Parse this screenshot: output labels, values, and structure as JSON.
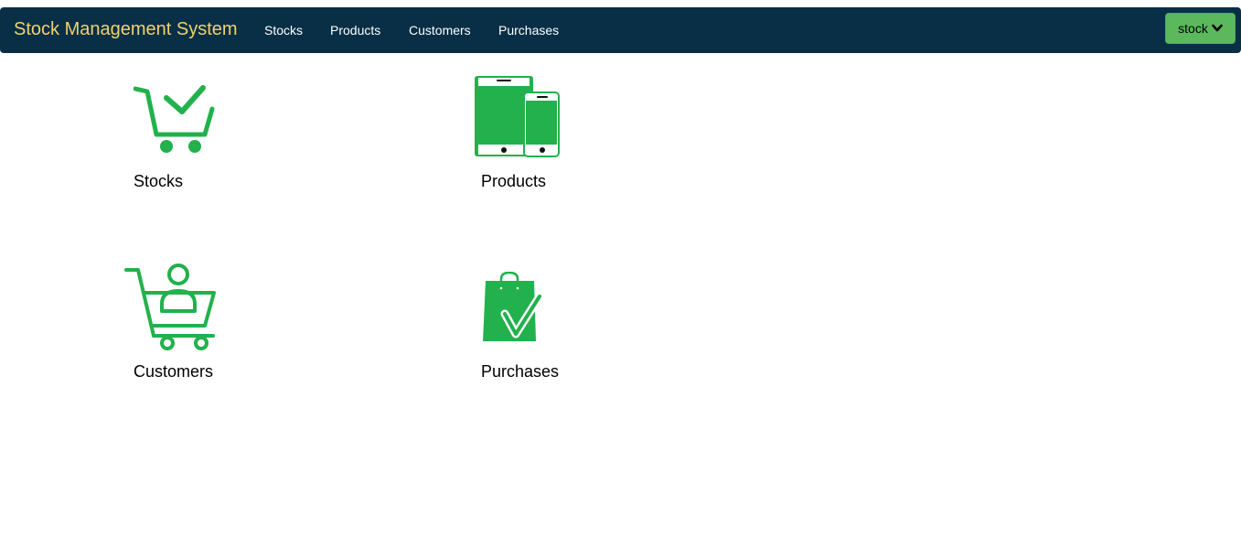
{
  "navbar": {
    "brand": "Stock Management System",
    "links": [
      "Stocks",
      "Products",
      "Customers",
      "Purchases"
    ],
    "user_menu_label": "stock",
    "user_menu_icon": "chevron-down-icon"
  },
  "tiles": [
    {
      "label": "Stocks",
      "icon": "cart-check-icon"
    },
    {
      "label": "Products",
      "icon": "tablet-phone-icon"
    },
    {
      "label": "Customers",
      "icon": "customer-cart-icon"
    },
    {
      "label": "Purchases",
      "icon": "shopping-bag-check-icon"
    }
  ],
  "colors": {
    "navbar_bg": "#082f45",
    "brand_text": "#f0d26e",
    "icon_green": "#22b14c",
    "button_green": "#5cb85c"
  }
}
